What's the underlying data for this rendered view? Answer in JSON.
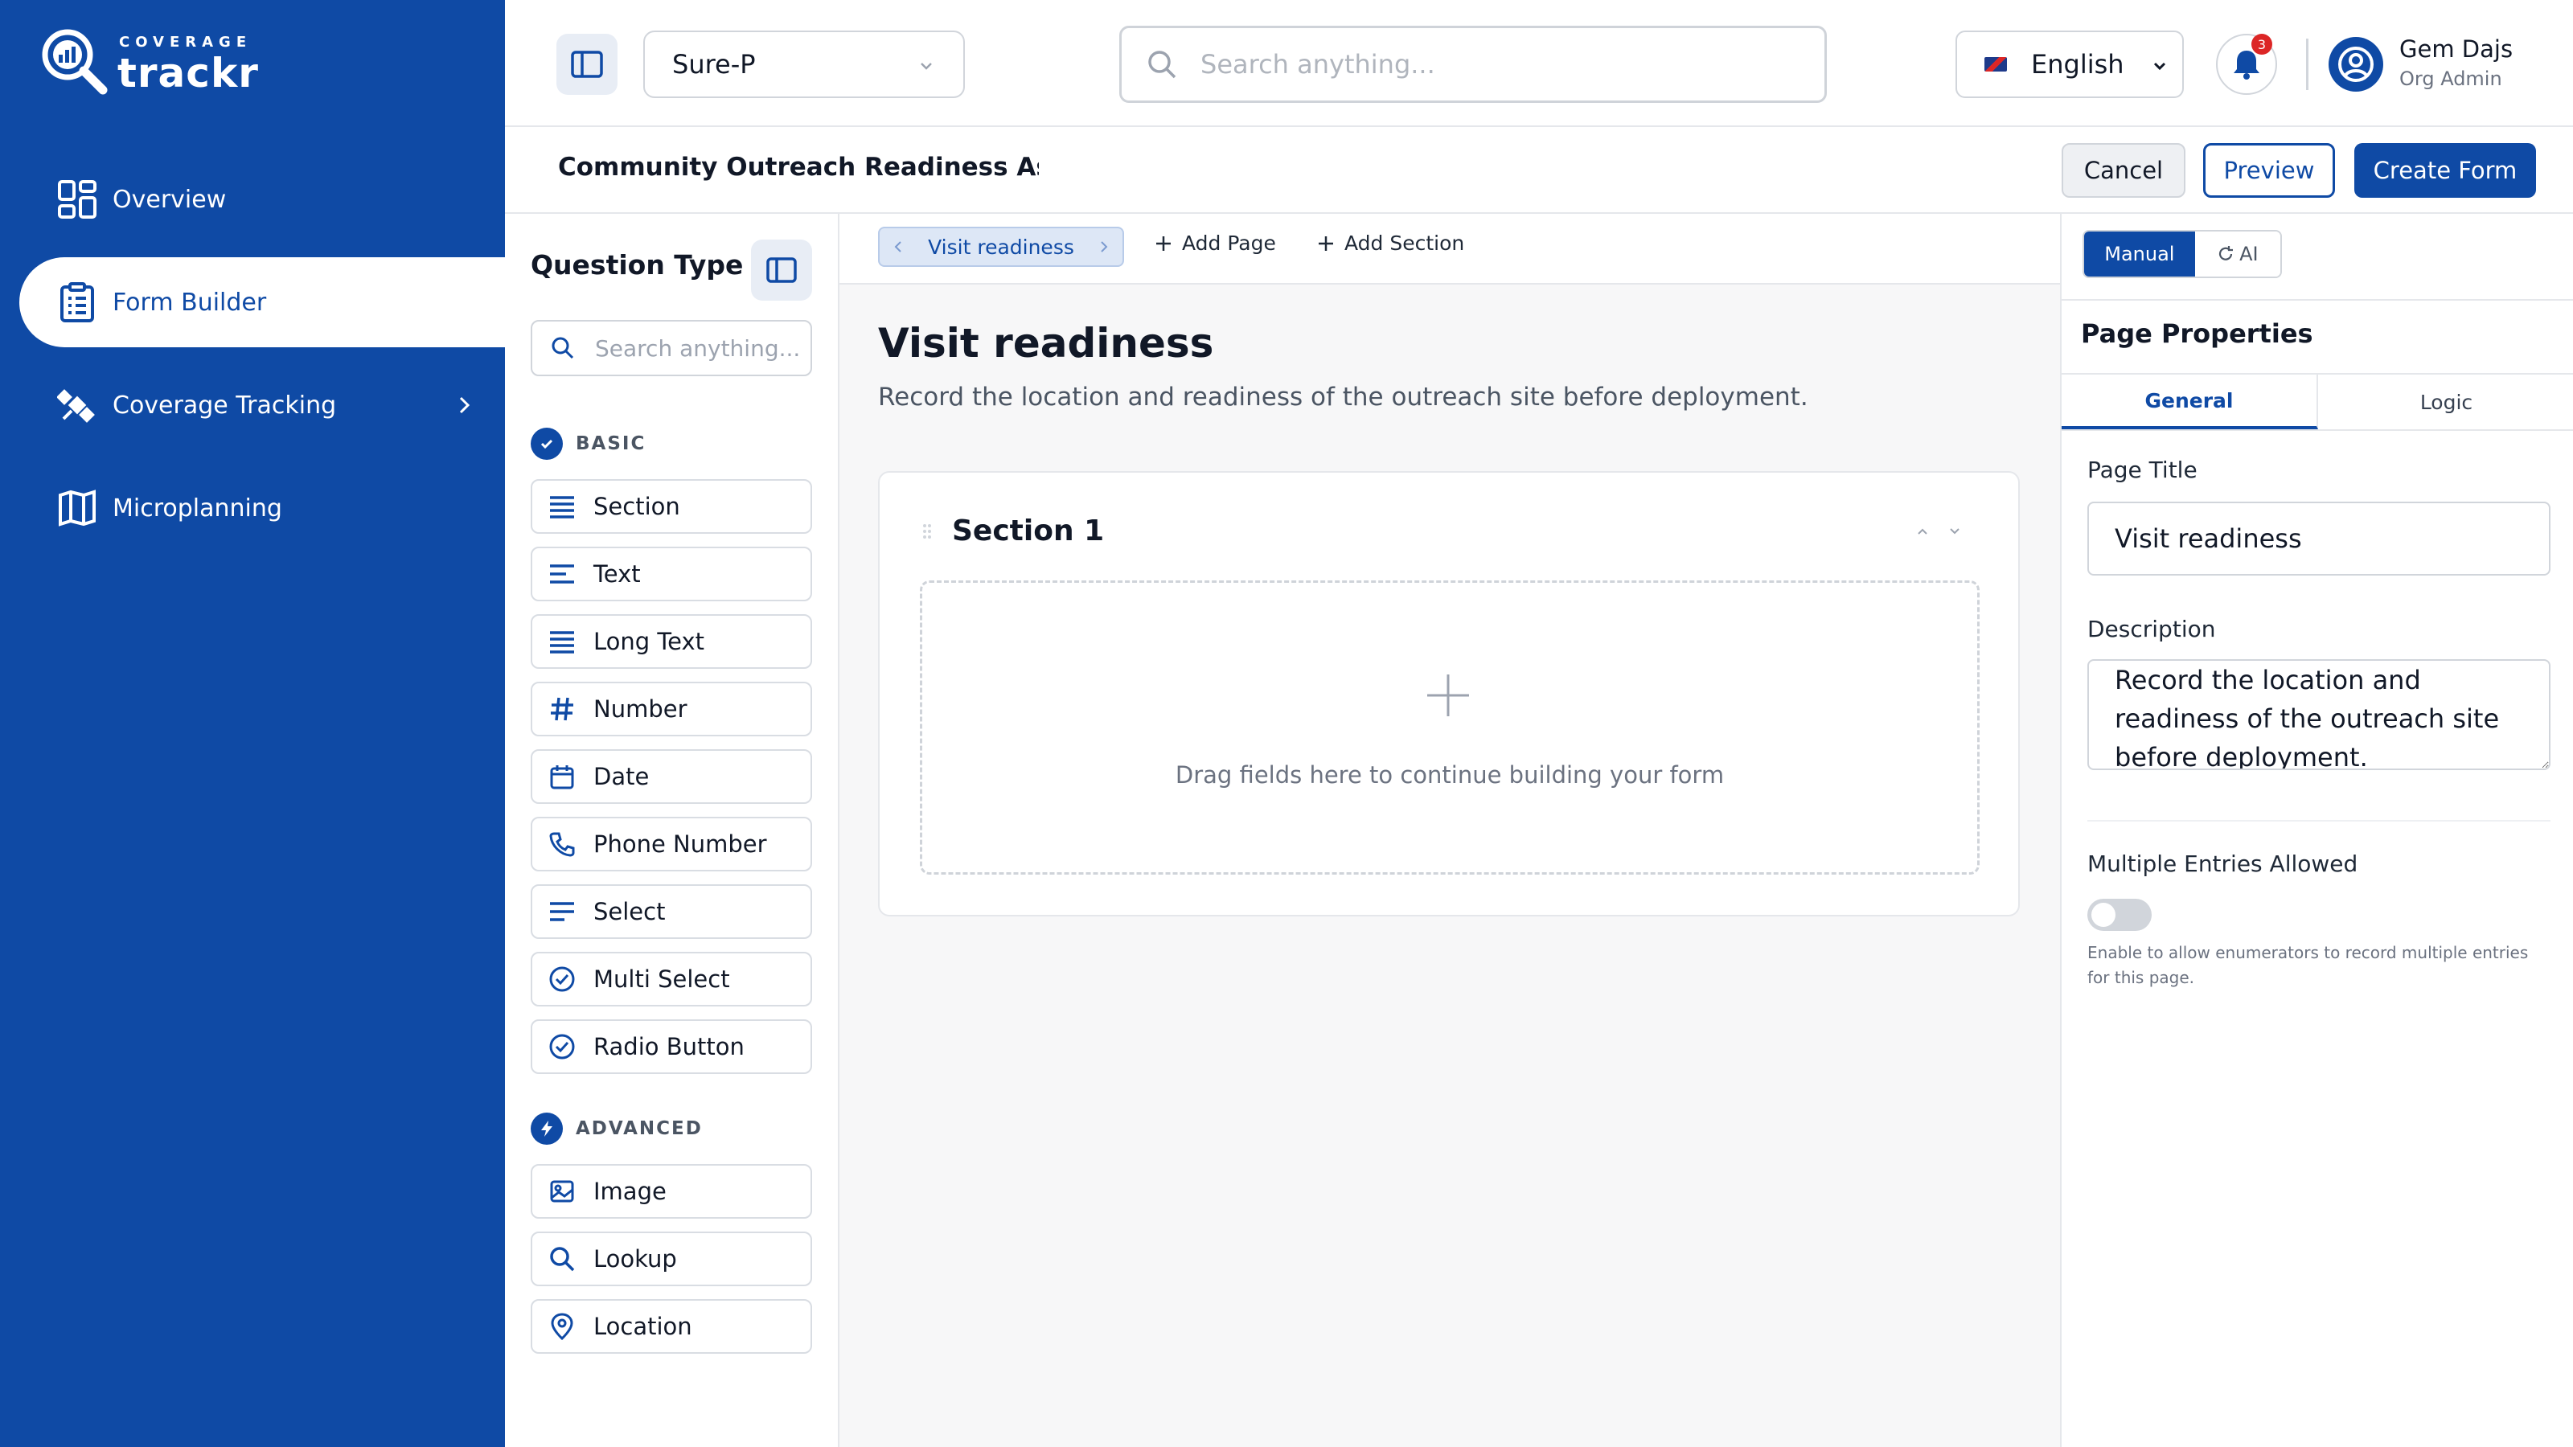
{
  "brand": {
    "tag": "COVERAGE",
    "name": "trackr"
  },
  "sidebar": {
    "items": [
      {
        "label": "Overview",
        "icon": "grid-icon",
        "active": false
      },
      {
        "label": "Form Builder",
        "icon": "clipboard-list-icon",
        "active": true
      },
      {
        "label": "Coverage Tracking",
        "icon": "satellite-icon",
        "active": false,
        "has_submenu": true
      },
      {
        "label": "Microplanning",
        "icon": "map-icon",
        "active": false
      }
    ]
  },
  "header": {
    "project": "Sure-P",
    "search_placeholder": "Search anything...",
    "language": "English",
    "notifications": "3",
    "user": {
      "name": "Gem Dajs",
      "role": "Org Admin"
    }
  },
  "titlebar": {
    "form_title": "Community Outreach Readiness Assessment",
    "cancel": "Cancel",
    "preview": "Preview",
    "create": "Create Form"
  },
  "question_panel": {
    "title": "Question Type",
    "search_placeholder": "Search anything...",
    "basic_label": "BASIC",
    "basic": [
      {
        "label": "Section",
        "icon": "section-lines-icon"
      },
      {
        "label": "Text",
        "icon": "short-text-icon"
      },
      {
        "label": "Long Text",
        "icon": "long-text-icon"
      },
      {
        "label": "Number",
        "icon": "hash-icon"
      },
      {
        "label": "Date",
        "icon": "calendar-icon"
      },
      {
        "label": "Phone Number",
        "icon": "phone-icon"
      },
      {
        "label": "Select",
        "icon": "select-lines-icon"
      },
      {
        "label": "Multi Select",
        "icon": "check-circle-icon"
      },
      {
        "label": "Radio Button",
        "icon": "check-circle-icon"
      }
    ],
    "advanced_label": "ADVANCED",
    "advanced": [
      {
        "label": "Image",
        "icon": "image-icon"
      },
      {
        "label": "Lookup",
        "icon": "search-icon"
      },
      {
        "label": "Location",
        "icon": "map-pin-icon"
      }
    ]
  },
  "canvas": {
    "active_page": "Visit readiness",
    "add_page": "Add Page",
    "add_section": "Add Section",
    "page_title": "Visit readiness",
    "page_description": "Record the location and readiness of the outreach site before deployment.",
    "section_title": "Section 1",
    "drop_hint": "Drag fields here to continue building your form"
  },
  "properties": {
    "mode_manual": "Manual",
    "mode_ai": "AI",
    "title": "Page Properties",
    "tab_general": "General",
    "tab_logic": "Logic",
    "page_title_label": "Page Title",
    "page_title_value": "Visit readiness",
    "description_label": "Description",
    "description_value": "Record the location and readiness of the outreach site before deployment.",
    "multiple_entries_label": "Multiple Entries Allowed",
    "multiple_entries_enabled": false,
    "multiple_entries_help": "Enable to allow enumerators to record multiple entries for this page."
  },
  "colors": {
    "brand": "#0f4aa5",
    "badge": "#dc2626"
  }
}
